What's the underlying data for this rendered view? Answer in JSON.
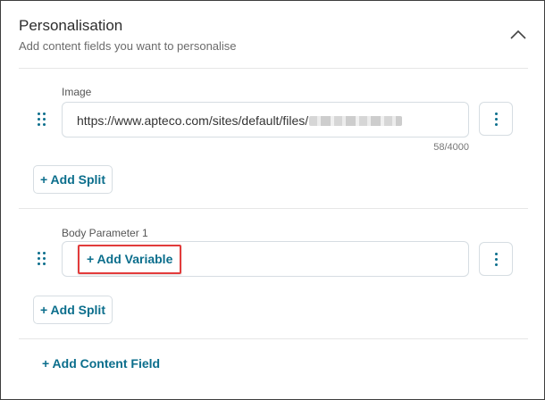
{
  "section": {
    "title": "Personalisation",
    "subtitle": "Add content fields you want to personalise"
  },
  "fields": [
    {
      "label": "Image",
      "value": "https://www.apteco.com/sites/default/files/",
      "counter": "58/4000",
      "add_split_label": "+ Add Split"
    },
    {
      "label": "Body Parameter 1",
      "add_variable_label": "+ Add Variable",
      "add_split_label": "+ Add Split"
    }
  ],
  "add_content_field_label": "+ Add Content Field",
  "icons": {
    "collapse": "chevron-up-icon",
    "drag": "drag-handle-icon",
    "menu": "kebab-menu-icon"
  },
  "colors": {
    "accent": "#0b6e8c",
    "highlight": "#e23b3b"
  }
}
